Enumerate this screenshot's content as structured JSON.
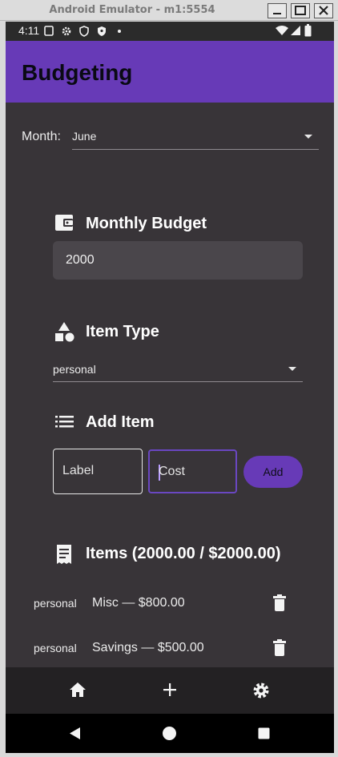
{
  "window": {
    "title": "Android Emulator - m1:5554"
  },
  "status_bar": {
    "time": "4:11"
  },
  "app_bar": {
    "title": "Budgeting"
  },
  "month": {
    "label": "Month:",
    "selected": "June"
  },
  "monthly_budget": {
    "heading": "Monthly Budget",
    "value": "2000"
  },
  "item_type": {
    "heading": "Item Type",
    "selected": "personal"
  },
  "add_item": {
    "heading": "Add Item",
    "label_placeholder": "Label",
    "cost_placeholder": "Cost",
    "add_button": "Add"
  },
  "items": {
    "heading": "Items (2000.00 / $2000.00)",
    "list": [
      {
        "type": "personal",
        "text": "Misc — $800.00"
      },
      {
        "type": "personal",
        "text": "Savings — $500.00"
      }
    ]
  },
  "colors": {
    "accent": "#673ab7",
    "background": "#383438",
    "field": "#4a464b"
  },
  "icons": {
    "bottom_nav": [
      "home-icon",
      "add-icon",
      "settings-icon"
    ],
    "system_nav": [
      "back-icon",
      "home-circle-icon",
      "recents-icon"
    ]
  }
}
